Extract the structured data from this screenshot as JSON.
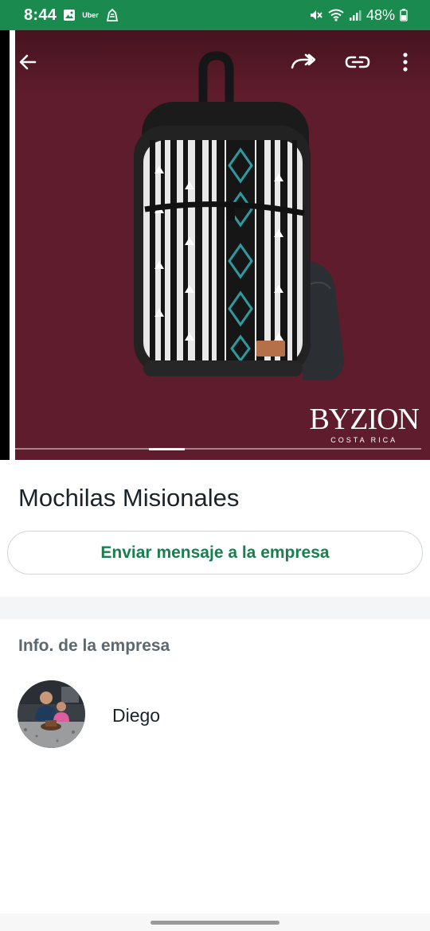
{
  "status_bar": {
    "time": "8:44",
    "uber_label": "Uber",
    "battery": "48%"
  },
  "hero": {
    "brand_name": "BYZION",
    "brand_sub": "COSTA RICA",
    "background_color": "#5e1c2c",
    "carousel_progress": 0.1
  },
  "product": {
    "title": "Mochilas Misionales"
  },
  "actions": {
    "message_button": "Enviar mensaje a la empresa"
  },
  "business_info": {
    "section_title": "Info. de la empresa",
    "contact_name": "Diego"
  },
  "colors": {
    "status_bar": "#1a8a4e",
    "accent": "#1a7f4f"
  },
  "icons": [
    "image-icon",
    "uber-icon",
    "app-icon",
    "mute-icon",
    "wifi-icon",
    "signal-icon",
    "battery-icon",
    "back-arrow-icon",
    "forward-icon",
    "link-icon",
    "more-vert-icon"
  ]
}
